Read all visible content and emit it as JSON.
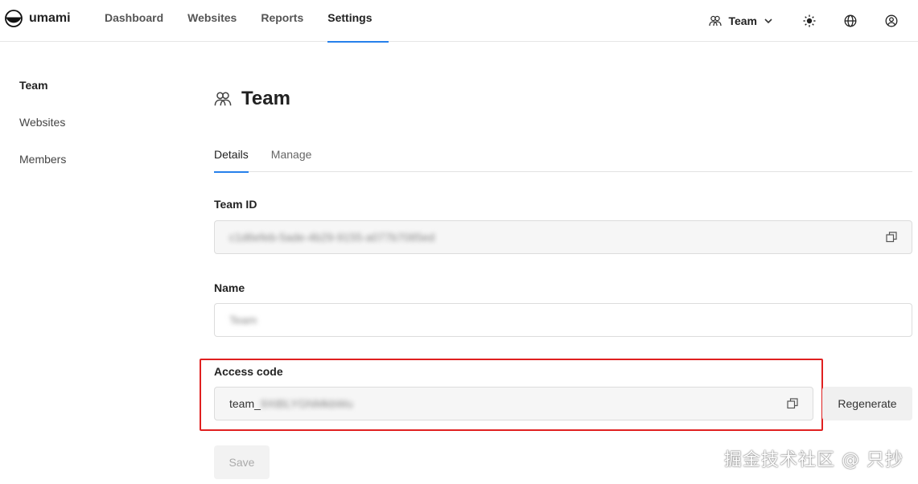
{
  "brand": {
    "name": "umami"
  },
  "nav": {
    "items": [
      {
        "label": "Dashboard",
        "active": false
      },
      {
        "label": "Websites",
        "active": false
      },
      {
        "label": "Reports",
        "active": false
      },
      {
        "label": "Settings",
        "active": true
      }
    ],
    "team_switch": {
      "label": "Team",
      "icon": "users-icon"
    },
    "icons": [
      "sun-icon",
      "globe-icon",
      "profile-icon"
    ]
  },
  "sidebar": {
    "items": [
      {
        "label": "Team",
        "active": true
      },
      {
        "label": "Websites",
        "active": false
      },
      {
        "label": "Members",
        "active": false
      }
    ]
  },
  "page": {
    "title": "Team",
    "tabs": [
      {
        "label": "Details",
        "active": true
      },
      {
        "label": "Manage",
        "active": false
      }
    ],
    "fields": {
      "team_id": {
        "label": "Team ID",
        "value": "c1d6efeb-5ade-4b29-9155-a077b7085ed"
      },
      "name": {
        "label": "Name",
        "value": "Team"
      },
      "access_code": {
        "label": "Access code",
        "prefix": "team_",
        "value": "9XtBLYGNMkbWu"
      }
    },
    "regenerate_label": "Regenerate",
    "save_label": "Save"
  },
  "colors": {
    "accent": "#2680eb",
    "highlight": "#e02020"
  },
  "watermark": "掘金技术社区 @ 只抄"
}
